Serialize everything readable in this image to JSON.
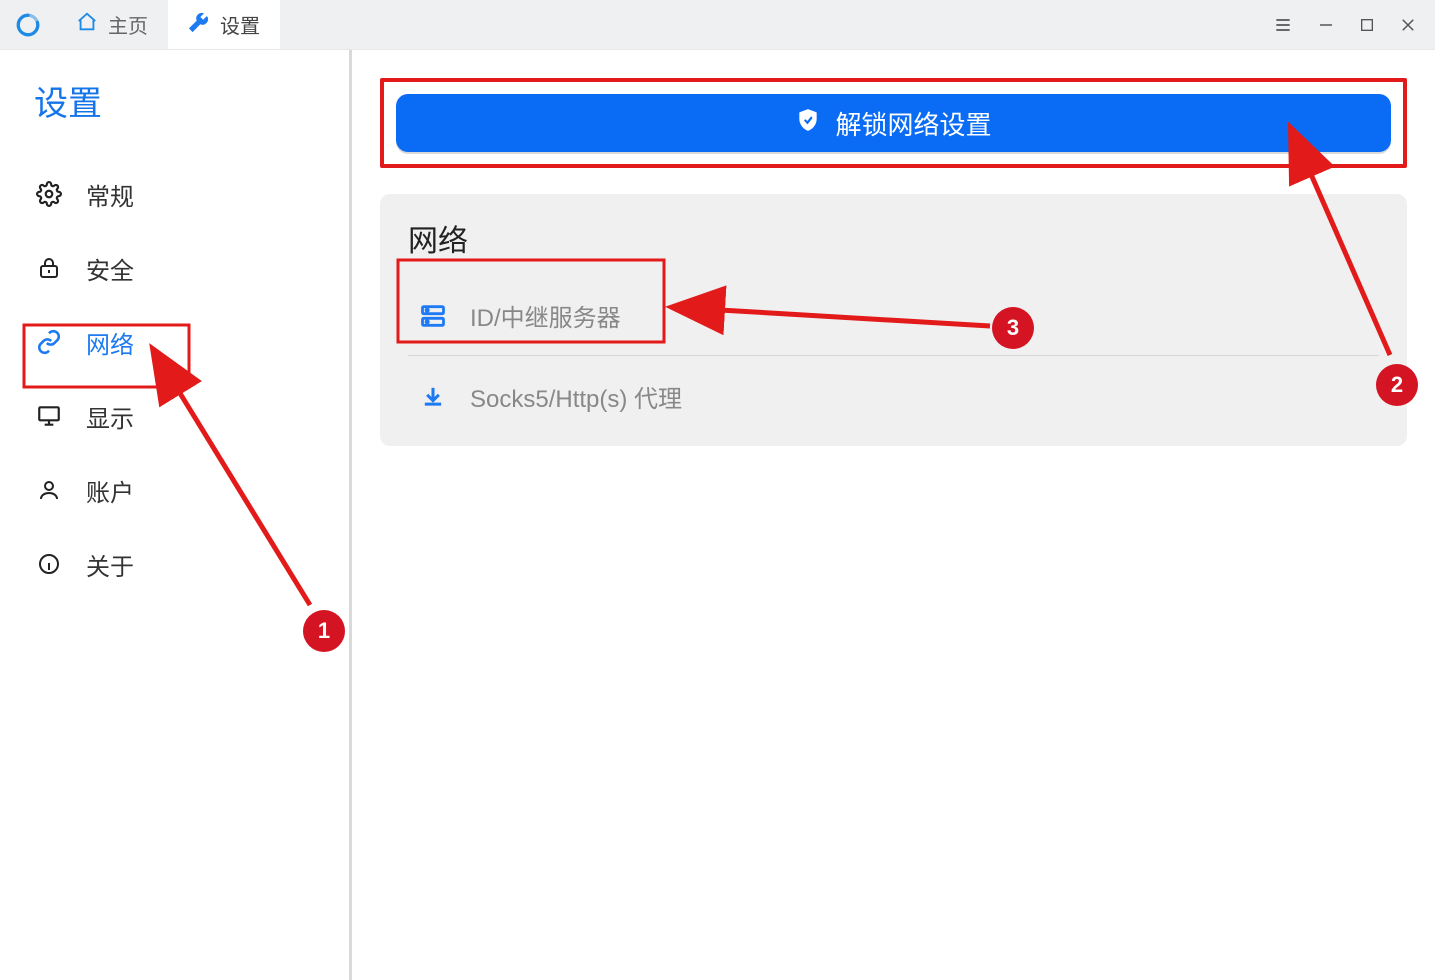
{
  "titlebar": {
    "tabs": [
      {
        "id": "home",
        "label": "主页"
      },
      {
        "id": "settings",
        "label": "设置"
      }
    ]
  },
  "sidebar": {
    "title": "设置",
    "items": [
      {
        "id": "general",
        "label": "常规"
      },
      {
        "id": "security",
        "label": "安全"
      },
      {
        "id": "network",
        "label": "网络"
      },
      {
        "id": "display",
        "label": "显示"
      },
      {
        "id": "account",
        "label": "账户"
      },
      {
        "id": "about",
        "label": "关于"
      }
    ],
    "active": "network"
  },
  "main": {
    "unlock_label": "解锁网络设置",
    "section_title": "网络",
    "options": [
      {
        "id": "relay",
        "label": "ID/中继服务器"
      },
      {
        "id": "proxy",
        "label": "Socks5/Http(s) 代理"
      }
    ]
  },
  "callouts": {
    "1": "1",
    "2": "2",
    "3": "3"
  }
}
